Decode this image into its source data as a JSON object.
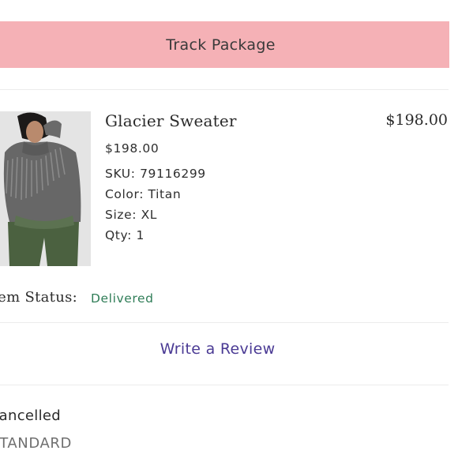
{
  "track_package": {
    "label": "Track Package"
  },
  "item": {
    "name": "Glacier Sweater",
    "total": "$198.00",
    "price": "$198.00",
    "sku": "SKU: 79116299",
    "color": "Color: Titan",
    "size": "Size: XL",
    "qty": "Qty: 1",
    "image_icon": "product-photo-icon"
  },
  "status": {
    "label": "Item Status:",
    "value": "Delivered",
    "value_color": "#2f7d57"
  },
  "review": {
    "label": "Write a Review",
    "color": "#4a3a94"
  },
  "next_item": {
    "status": "Cancelled",
    "shipping": "STANDARD"
  },
  "colors": {
    "track_button_bg": "#f5b1b6"
  }
}
